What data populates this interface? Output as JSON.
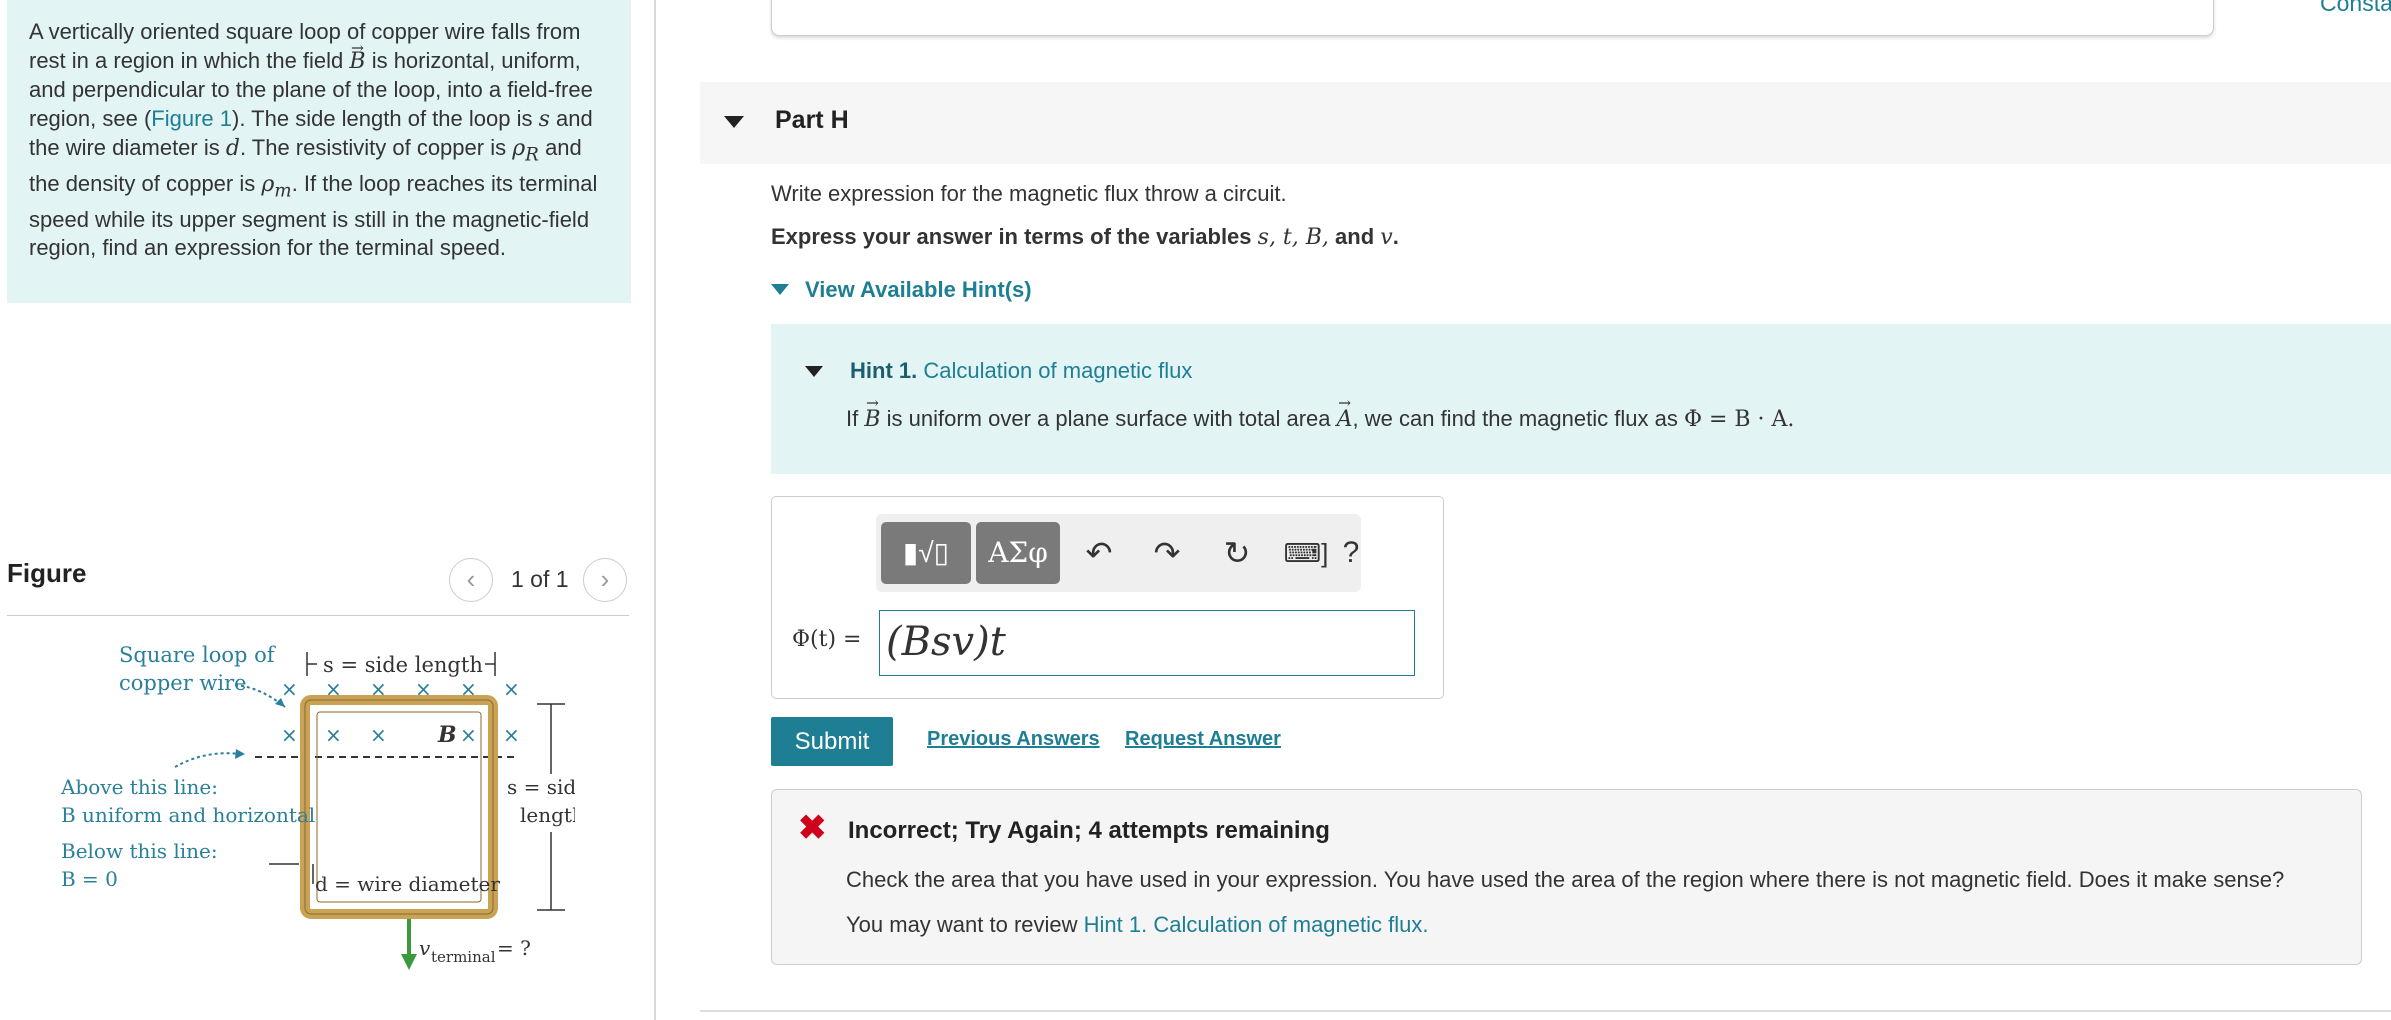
{
  "problem": {
    "text_1": "A vertically oriented square loop of copper wire falls from rest in a region in which the field ",
    "text_B": "B",
    "text_2": " is horizontal, uniform, and perpendicular to the plane of the loop, into a field-free region, see (",
    "figure_link": "Figure 1",
    "text_3": "). The side length of the loop is ",
    "var_s": "s",
    "text_4": " and the wire diameter is ",
    "var_d": "d",
    "text_5": ". The resistivity of copper is ",
    "var_rhoR": "ρ",
    "sub_R": "R",
    "text_6": " and the density of copper is ",
    "var_rhom": "ρ",
    "sub_m": "m",
    "text_7": ". If the loop reaches its terminal speed while its upper segment is still in the magnetic-field region, find an expression for the terminal speed."
  },
  "figure_panel": {
    "title": "Figure",
    "pager_text": "1 of 1",
    "prev_icon": "‹",
    "next_icon": "›"
  },
  "figure": {
    "label_loop_1": "Square loop of",
    "label_loop_2": "copper wire",
    "label_side_top": "s = side length",
    "label_B": "B",
    "label_above_1": "Above this line:",
    "label_above_2": "B uniform and horizontal",
    "label_below_1": "Below this line:",
    "label_below_2": "B = 0",
    "label_side_right_1": "s = side",
    "label_side_right_2": "length",
    "label_diameter": "d = wire diameter",
    "label_vterm": "v",
    "label_vterm_sub": "terminal",
    "label_vterm_eq": "= ?"
  },
  "header": {
    "constants_link": "Consta"
  },
  "part": {
    "title": "Part H",
    "instruction": "Write expression for the magnetic flux throw a circuit.",
    "express_prefix": "Express your answer in terms of the variables ",
    "express_vars": "s, t, B,",
    "express_and": " and ",
    "express_last": "v",
    "express_end": "."
  },
  "hints": {
    "toggle_label": "View Available Hint(s)",
    "hint1_number": "Hint 1.",
    "hint1_title": "Calculation of magnetic flux",
    "hint1_body_1": "If ",
    "hint1_body_B": "B",
    "hint1_body_2": " is uniform over a plane surface with total area ",
    "hint1_body_A": "A",
    "hint1_body_3": ", we can find the magnetic flux as ",
    "hint1_formula": "Φ = B · A."
  },
  "answer": {
    "label": "Φ(t) =",
    "value": "(Bsv)t",
    "toolbar": {
      "templates_icon": "▮√▯",
      "symbols_label": "ΑΣφ",
      "undo_icon": "↶",
      "redo_icon": "↷",
      "reset_icon": "↻",
      "keyboard_icon": "⌨]",
      "help_label": "?"
    }
  },
  "actions": {
    "submit": "Submit",
    "previous_answers": "Previous Answers",
    "request_answer": "Request Answer"
  },
  "feedback": {
    "icon": "✖",
    "title": "Incorrect; Try Again; 4 attempts remaining",
    "line1": "Check the area that you have used in your expression. You have used the area of the region where there is not  magnetic field. Does it make sense?",
    "line2_prefix": "You may want to review ",
    "line2_link": "Hint 1. Calculation of magnetic flux."
  },
  "colors": {
    "accent": "#1d7e94",
    "hint_bg": "#e3f4f4",
    "error": "#d0021b",
    "loop_wire": "#c9a255"
  }
}
